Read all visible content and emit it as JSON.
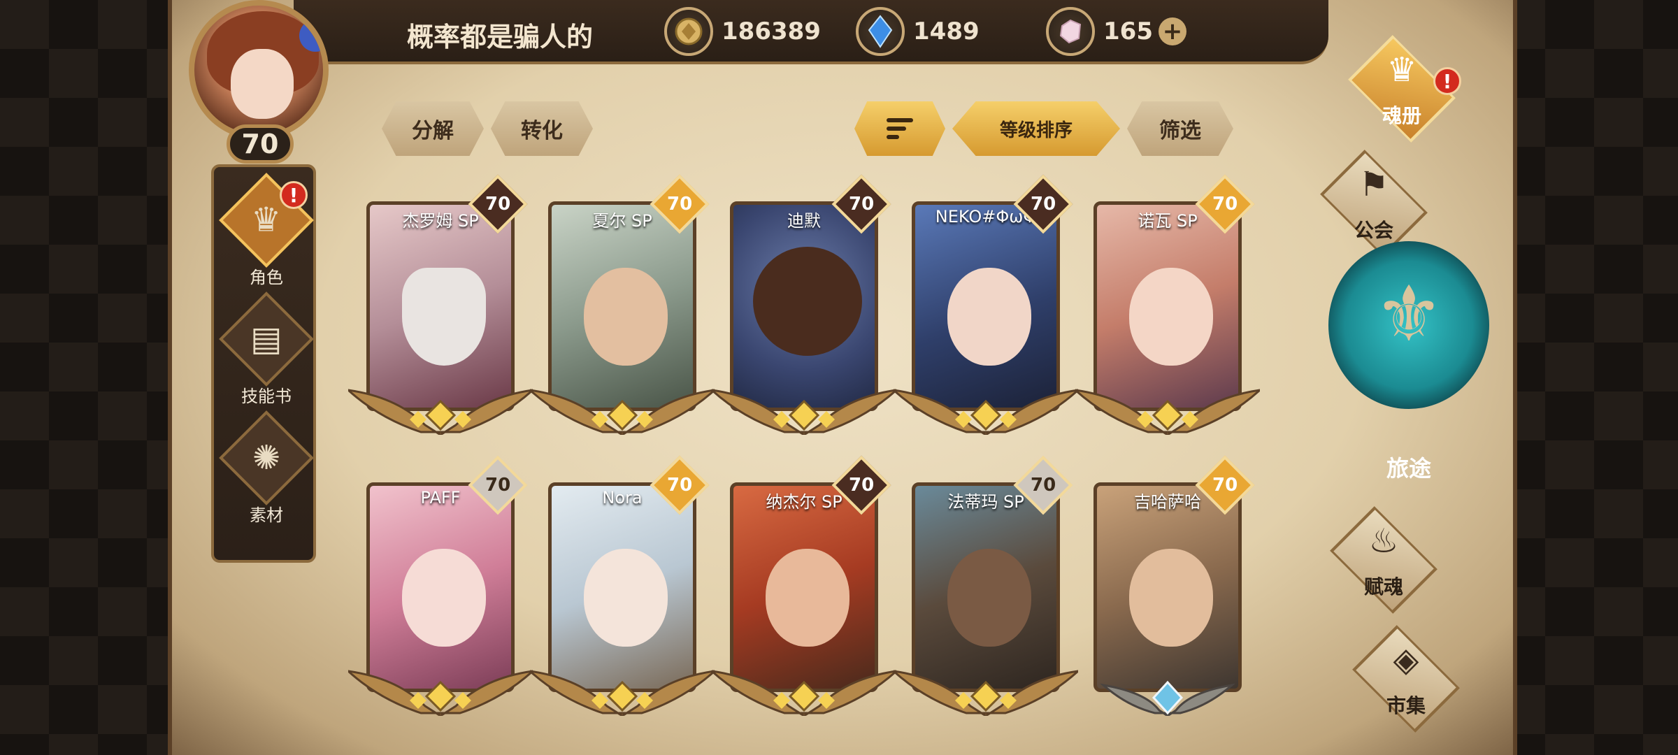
{
  "header": {
    "player_name": "概率都是骗人的",
    "level": "70",
    "currencies": [
      {
        "icon": "gold-coin-icon",
        "value": "186389"
      },
      {
        "icon": "blue-crystal-icon",
        "value": "1489"
      },
      {
        "icon": "gem-icon",
        "value": "165"
      }
    ],
    "plus_label": "+"
  },
  "left_nav": [
    {
      "label": "角色",
      "icon": "character-icon"
    },
    {
      "label": "技能书",
      "icon": "skill-book-icon"
    },
    {
      "label": "素材",
      "icon": "material-icon"
    }
  ],
  "toolbar": {
    "decompose": "分解",
    "convert": "转化",
    "sort_level": "等级排序",
    "filter": "筛选"
  },
  "cards": [
    {
      "name": "杰罗姆 SP",
      "level": "70",
      "badge": "dark"
    },
    {
      "name": "夏尔 SP",
      "level": "70",
      "badge": "gold"
    },
    {
      "name": "迪默",
      "level": "70",
      "badge": "dark"
    },
    {
      "name": "NEKO#ΦωΦ",
      "level": "70",
      "badge": "dark"
    },
    {
      "name": "诺瓦 SP",
      "level": "70",
      "badge": "gold"
    },
    {
      "name": "PAFF",
      "level": "70",
      "badge": "silver"
    },
    {
      "name": "Nora",
      "level": "70",
      "badge": "gold"
    },
    {
      "name": "纳杰尔 SP",
      "level": "70",
      "badge": "dark"
    },
    {
      "name": "法蒂玛 SP",
      "level": "70",
      "badge": "silver"
    },
    {
      "name": "吉哈萨哈",
      "level": "70",
      "badge": "gold"
    }
  ],
  "right_nav": {
    "soul_book": "魂册",
    "guild": "公会",
    "journey": "旅途",
    "endow_soul": "赋魂",
    "market": "市集"
  },
  "colors": {
    "accent_gold": "#e9a733",
    "alert_red": "#d32a1e",
    "journey_teal": "#34c2c6"
  }
}
